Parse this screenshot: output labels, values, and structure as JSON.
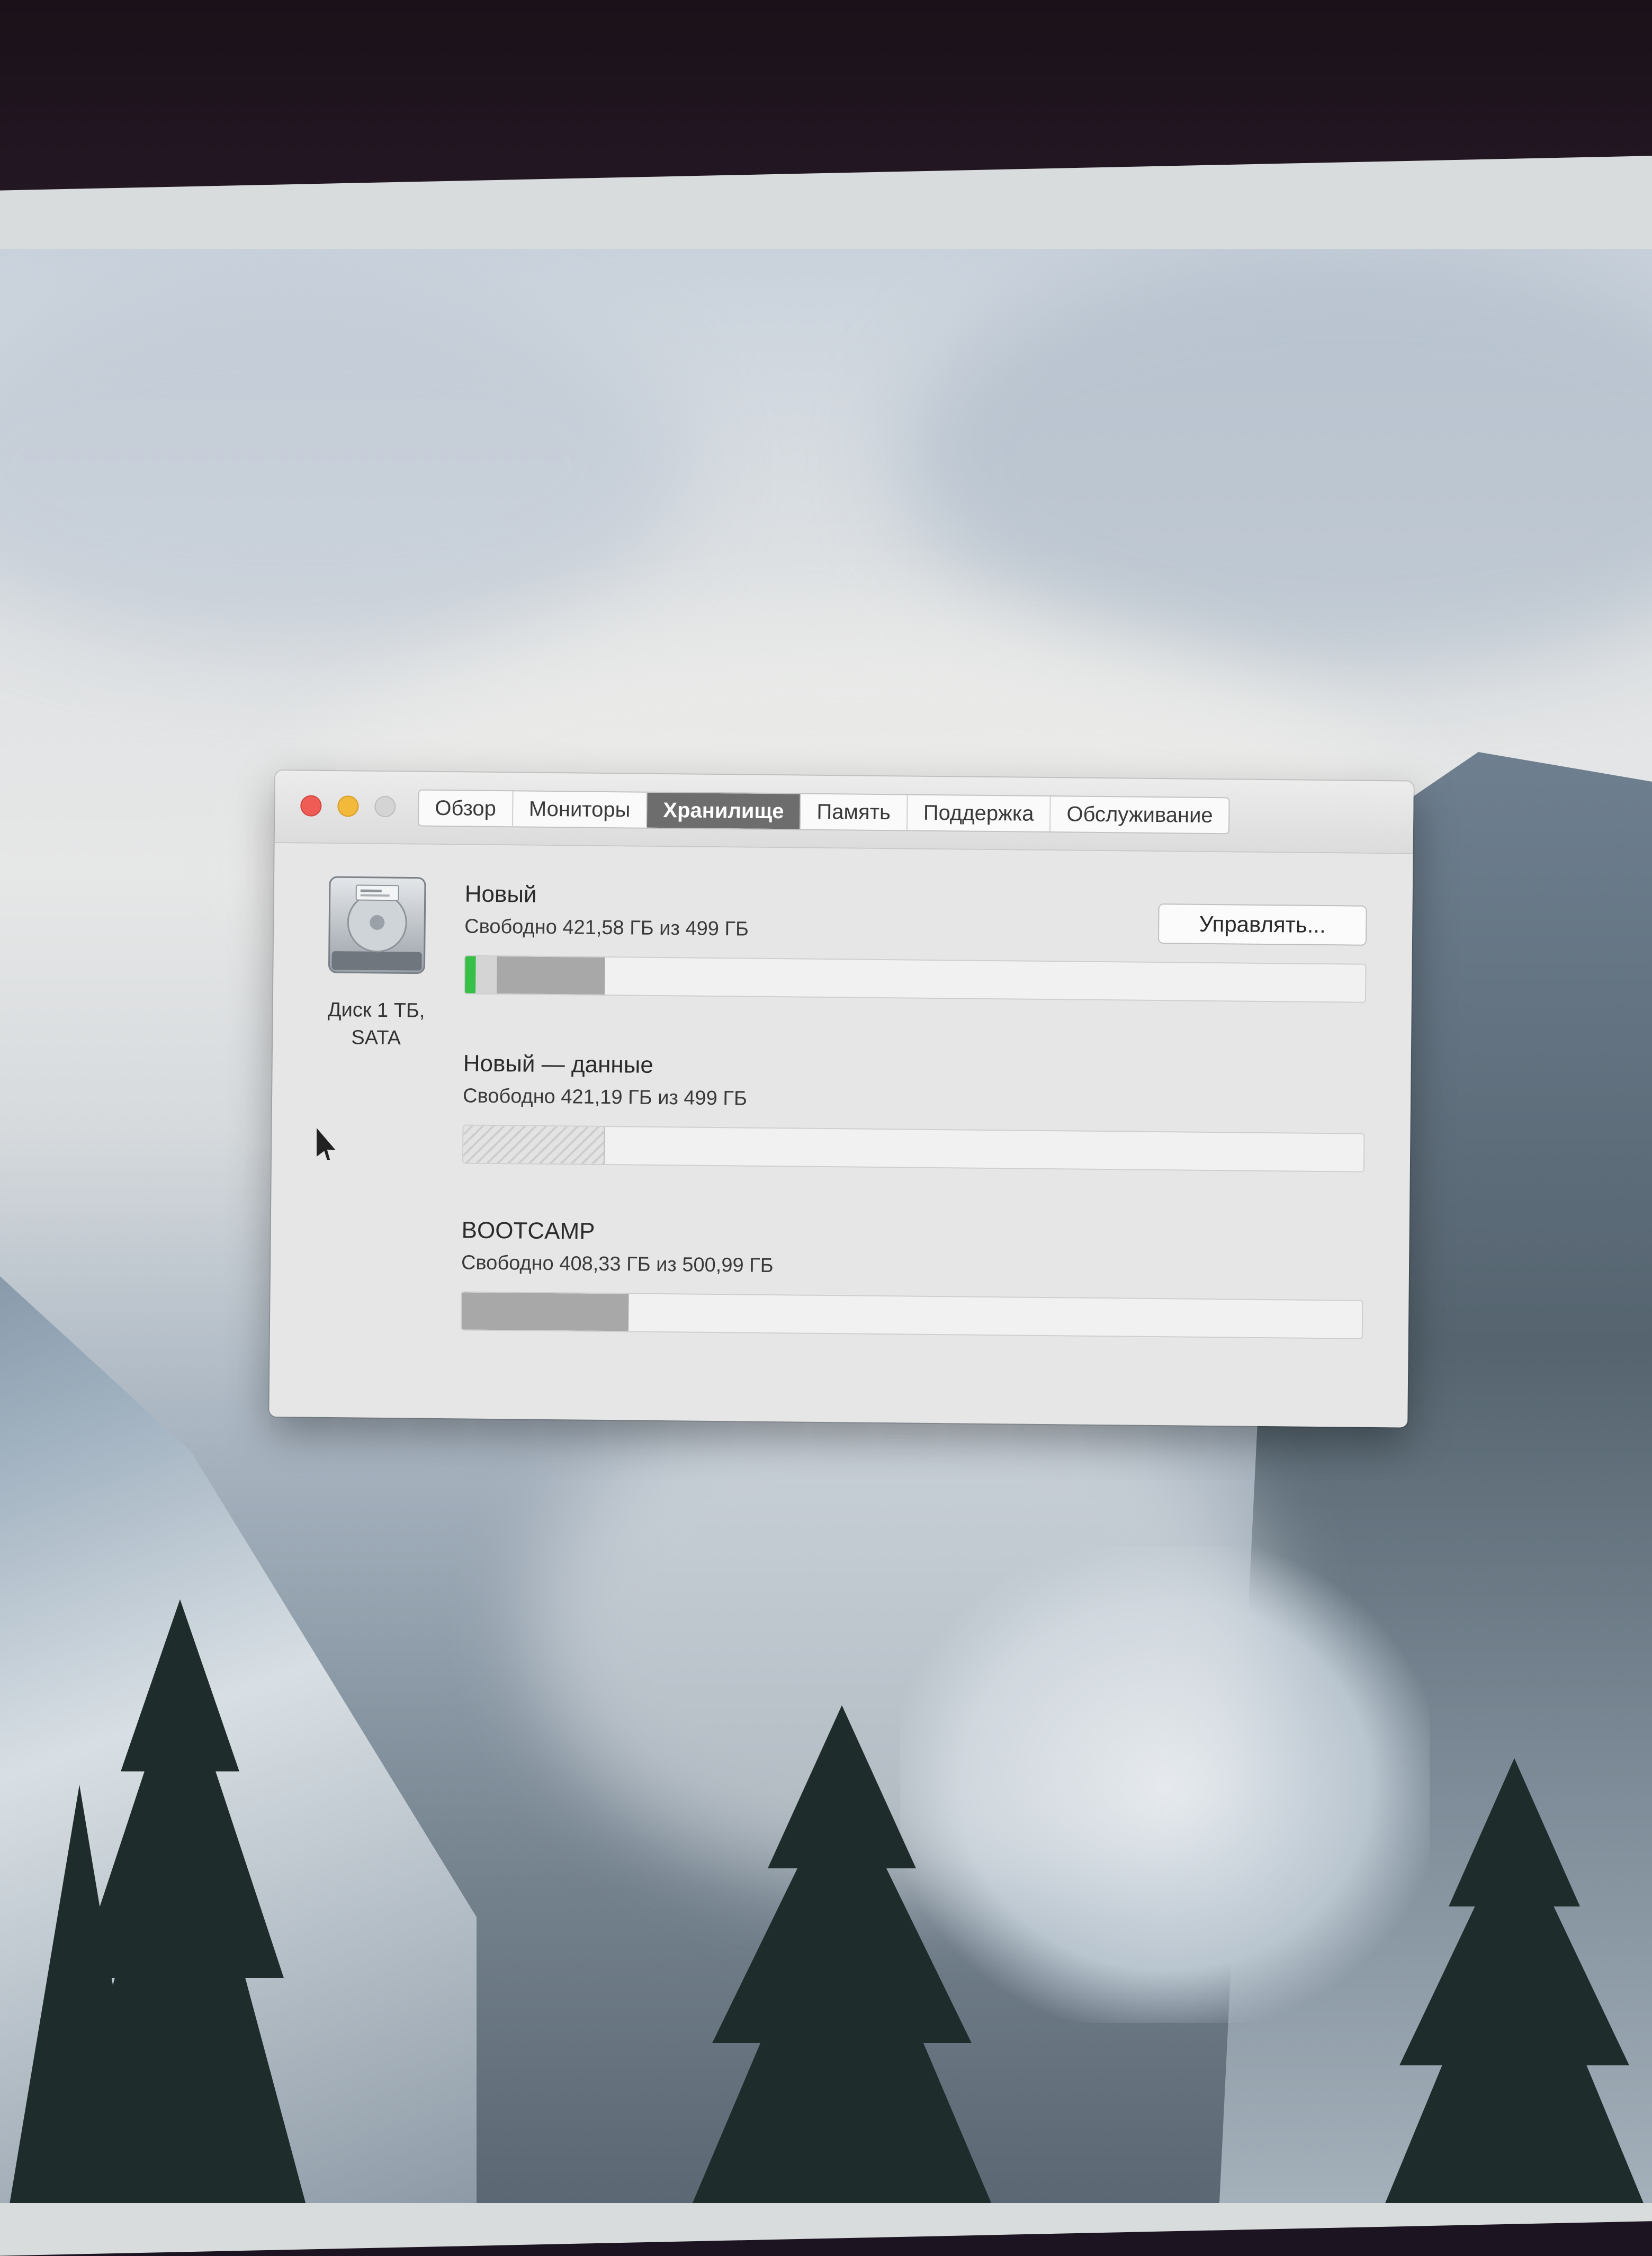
{
  "window": {
    "tabs": [
      {
        "label": "Обзор"
      },
      {
        "label": "Мониторы"
      },
      {
        "label": "Хранилище"
      },
      {
        "label": "Память"
      },
      {
        "label": "Поддержка"
      },
      {
        "label": "Обслуживание"
      }
    ],
    "active_tab": "Хранилище"
  },
  "disk": {
    "icon": "hard-drive-icon",
    "label_line1": "Диск 1 ТБ,",
    "label_line2": "SATA"
  },
  "volumes": [
    {
      "name": "Новый",
      "free_text": "Свободно 421,58 ГБ из 499 ГБ",
      "used_fraction": 0.155
    },
    {
      "name": "Новый — данные",
      "free_text": "Свободно 421,19 ГБ из 499 ГБ",
      "used_fraction": 0.156
    },
    {
      "name": "BOOTCAMP",
      "free_text": "Свободно 408,33 ГБ из 500,99 ГБ",
      "used_fraction": 0.185
    }
  ],
  "manage_button": {
    "label": "Управлять..."
  },
  "colors": {
    "close": "#ee5c55",
    "minimize": "#f3b93a",
    "zoom": "#d4d4d4",
    "active_tab": "#6d6d6d",
    "bar_green": "#37c048",
    "bar_used": "#a8a8a8"
  }
}
